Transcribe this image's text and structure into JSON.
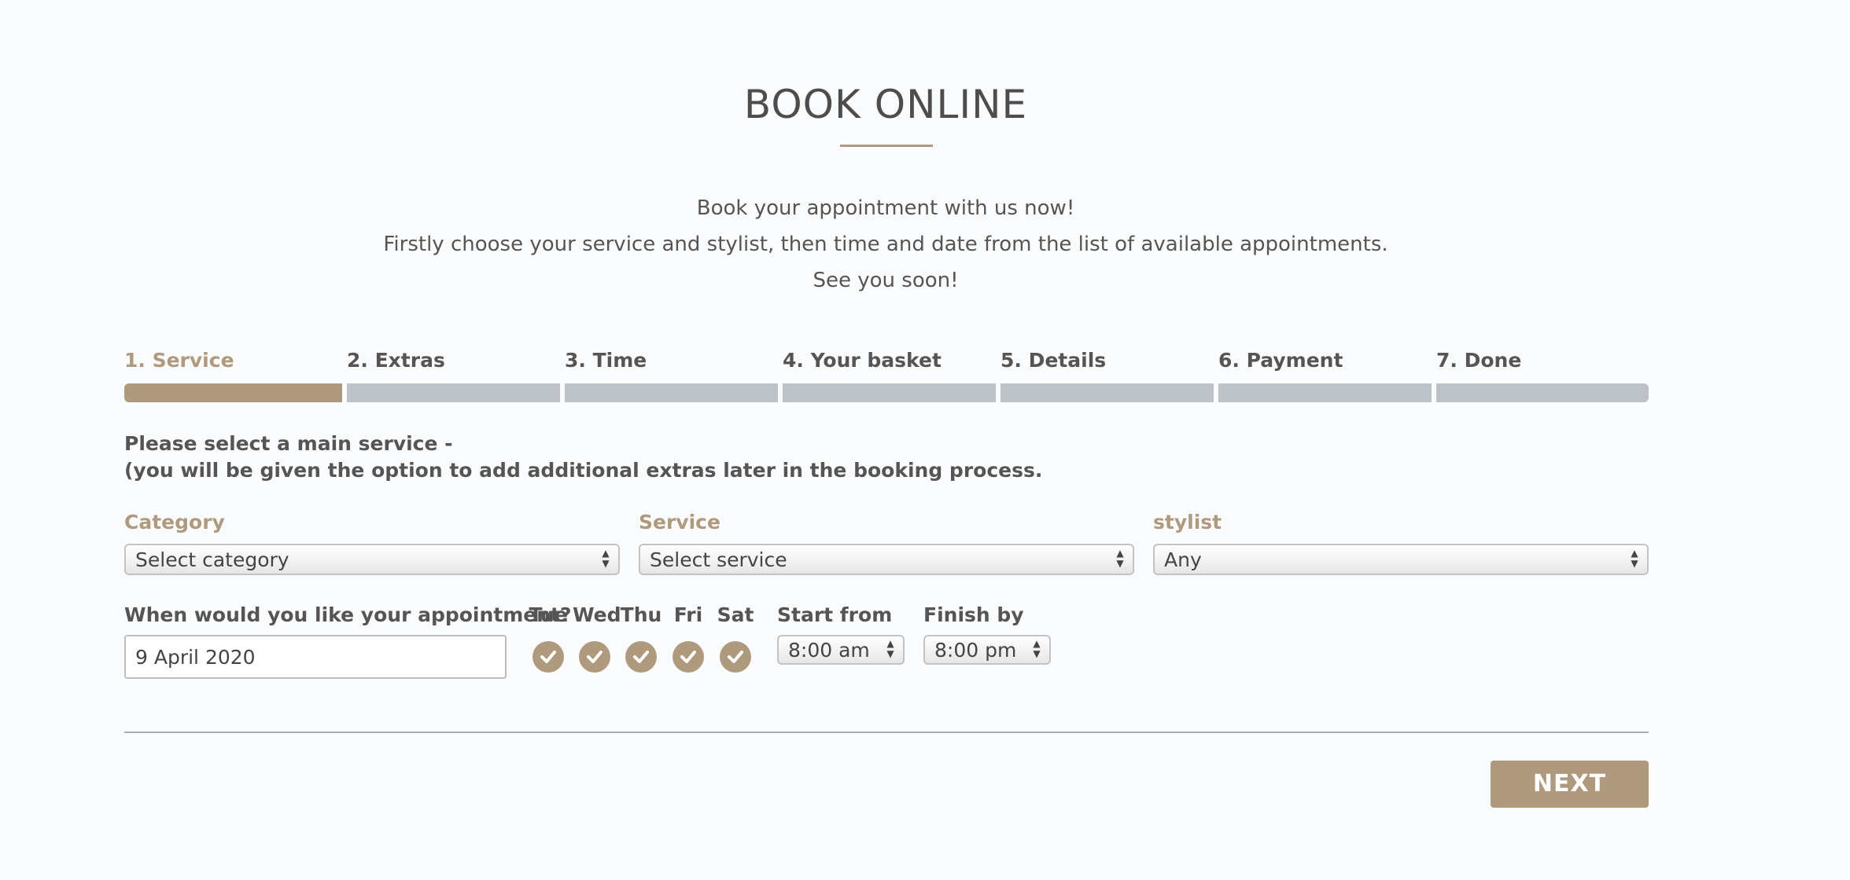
{
  "header": {
    "title": "BOOK ONLINE",
    "intro_lines": [
      "Book your appointment with us now!",
      "Firstly choose your service and stylist, then time and date from the list of available appointments.",
      "See you soon!"
    ]
  },
  "steps": [
    {
      "label": "1. Service",
      "active": true
    },
    {
      "label": "2. Extras",
      "active": false
    },
    {
      "label": "3. Time",
      "active": false
    },
    {
      "label": "4. Your basket",
      "active": false
    },
    {
      "label": "5. Details",
      "active": false
    },
    {
      "label": "6. Payment",
      "active": false
    },
    {
      "label": "7. Done",
      "active": false
    }
  ],
  "instructions": {
    "line1": "Please select a main service -",
    "line2": "(you will be given the option to add additional extras later in the booking process."
  },
  "fields": {
    "category": {
      "label": "Category",
      "value": "Select category"
    },
    "service": {
      "label": "Service",
      "value": "Select service"
    },
    "stylist": {
      "label": "stylist",
      "value": "Any"
    }
  },
  "when": {
    "label": "When would you like your appointment?",
    "date_value": "9 April 2020"
  },
  "days": [
    {
      "label": "Tue",
      "checked": true
    },
    {
      "label": "Wed",
      "checked": true
    },
    {
      "label": "Thu",
      "checked": true
    },
    {
      "label": "Fri",
      "checked": true
    },
    {
      "label": "Sat",
      "checked": true
    }
  ],
  "time": {
    "start_label": "Start from",
    "start_value": "8:00 am",
    "finish_label": "Finish by",
    "finish_value": "8:00 pm"
  },
  "actions": {
    "next_label": "NEXT"
  },
  "colors": {
    "accent": "#b09a7e",
    "inactive_step": "#bcc2c7",
    "text": "#555555"
  }
}
